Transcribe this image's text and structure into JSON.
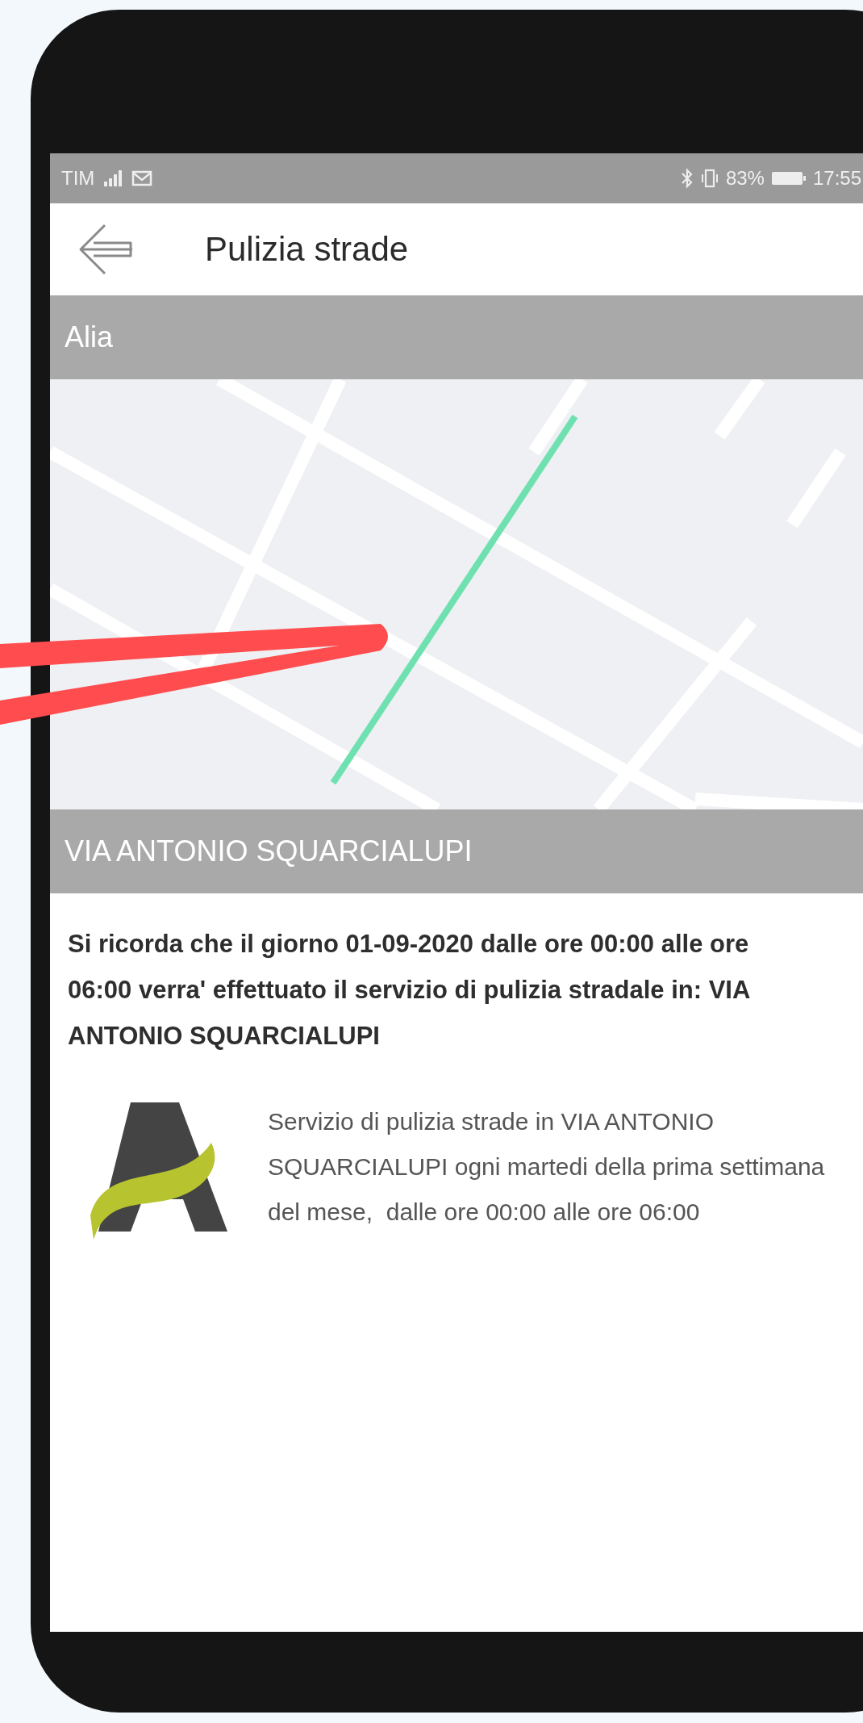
{
  "status_bar": {
    "carrier": "TIM",
    "battery": "83%",
    "time": "17:55"
  },
  "app_bar": {
    "title": "Pulizia strade"
  },
  "provider_header": "Alia",
  "street_header": "VIA ANTONIO SQUARCIALUPI",
  "notice": "Si ricorda che il giorno 01-09-2020 dalle ore 00:00 alle ore 06:00 verra' effettuato il servizio di pulizia stradale in: VIA ANTONIO SQUARCIALUPI",
  "service_card": {
    "description": "Servizio di pulizia strade in VIA ANTONIO SQUARCIALUPI ogni martedi della prima settimana del mese,  dalle ore 00:00 alle ore 06:00"
  }
}
